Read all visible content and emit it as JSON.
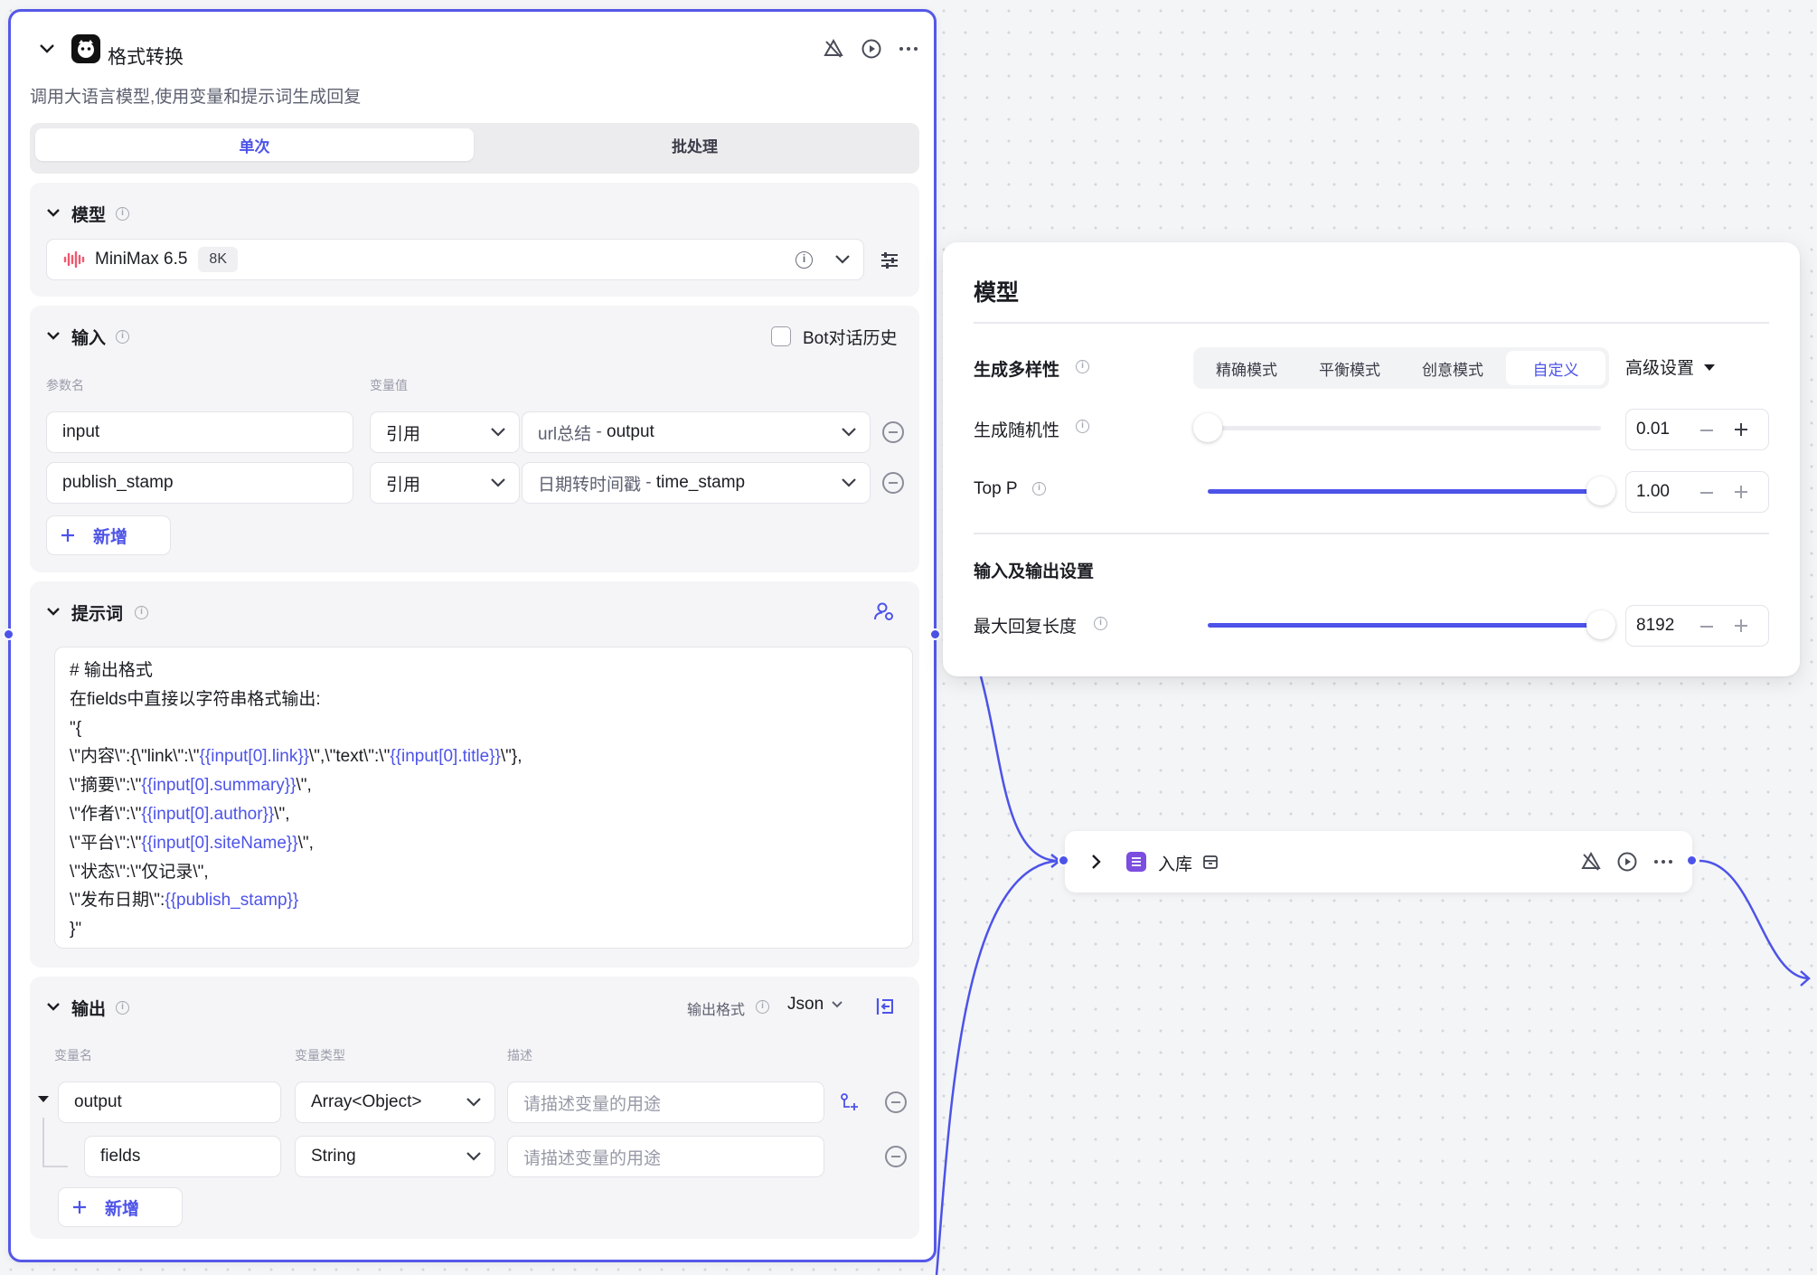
{
  "node": {
    "title": "格式转换",
    "description": "调用大语言模型,使用变量和提示词生成回复",
    "tabs": [
      {
        "label": "单次",
        "active": true
      },
      {
        "label": "批处理",
        "active": false
      }
    ],
    "model_section": {
      "title": "模型",
      "model_name": "MiniMax 6.5",
      "context_badge": "8K"
    },
    "input_section": {
      "title": "输入",
      "history_label": "Bot对话历史",
      "history_checked": false,
      "col_name": "参数名",
      "col_value": "变量值",
      "rows": [
        {
          "name": "input",
          "ref": "引用",
          "source": "url总结",
          "sep": " - ",
          "field": "output"
        },
        {
          "name": "publish_stamp",
          "ref": "引用",
          "source": "日期转时间戳",
          "sep": " - ",
          "field": "time_stamp"
        }
      ],
      "add_label": "新增"
    },
    "prompt_section": {
      "title": "提示词",
      "lines": [
        [
          {
            "t": "# 输出格式"
          }
        ],
        [
          {
            "t": "在fields中直接以字符串格式输出:"
          }
        ],
        [
          {
            "t": "\"{"
          }
        ],
        [
          {
            "t": "\\\"内容\\\":{\\\"link\\\":\\\""
          },
          {
            "t": "{{input[0].link}}",
            "v": true
          },
          {
            "t": "\\\",\\\"text\\\":\\\""
          },
          {
            "t": "{{input[0].title}}",
            "v": true
          },
          {
            "t": "\\\"},"
          }
        ],
        [
          {
            "t": "\\\"摘要\\\":\\\""
          },
          {
            "t": "{{input[0].summary}}",
            "v": true
          },
          {
            "t": "\\\","
          }
        ],
        [
          {
            "t": "\\\"作者\\\":\\\""
          },
          {
            "t": "{{input[0].author}}",
            "v": true
          },
          {
            "t": "\\\","
          }
        ],
        [
          {
            "t": "\\\"平台\\\":\\\""
          },
          {
            "t": "{{input[0].siteName}}",
            "v": true
          },
          {
            "t": "\\\","
          }
        ],
        [
          {
            "t": "\\\"状态\\\":\\\"仅记录\\\","
          }
        ],
        [
          {
            "t": "\\\"发布日期\\\":"
          },
          {
            "t": "{{publish_stamp}}",
            "v": true
          }
        ],
        [
          {
            "t": "}\""
          }
        ]
      ]
    },
    "output_section": {
      "title": "输出",
      "format_label": "输出格式",
      "format_value": "Json",
      "col_name": "变量名",
      "col_type": "变量类型",
      "col_desc": "描述",
      "rows": [
        {
          "name": "output",
          "type": "Array<Object>",
          "desc_placeholder": "请描述变量的用途"
        },
        {
          "name": "fields",
          "type": "String",
          "desc_placeholder": "请描述变量的用途"
        }
      ],
      "add_label": "新增"
    }
  },
  "model_panel": {
    "title": "模型",
    "diversity_label": "生成多样性",
    "modes": [
      {
        "label": "精确模式",
        "active": false
      },
      {
        "label": "平衡模式",
        "active": false
      },
      {
        "label": "创意模式",
        "active": false
      },
      {
        "label": "自定义",
        "active": true
      }
    ],
    "advanced_label": "高级设置",
    "temperature": {
      "label": "生成随机性",
      "value": "0.01",
      "fraction": 0.0
    },
    "top_p": {
      "label": "Top P",
      "value": "1.00",
      "fraction": 1.0
    },
    "io_title": "输入及输出设置",
    "max_tokens": {
      "label": "最大回复长度",
      "value": "8192",
      "fraction": 1.0
    }
  },
  "node2": {
    "title": "入库"
  },
  "colors": {
    "accent": "#4d53e8",
    "border_selected": "#5558e8",
    "node2_icon": "#7c4ddf"
  }
}
